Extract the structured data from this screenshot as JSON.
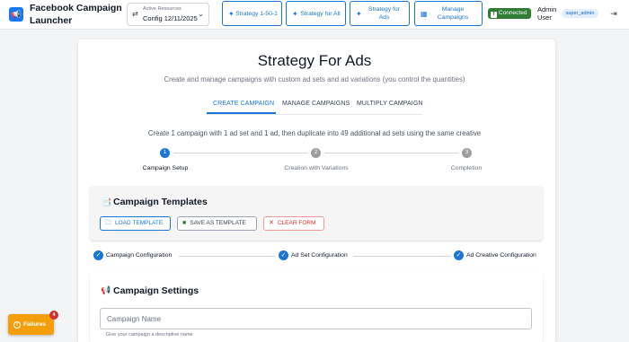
{
  "header": {
    "app_title": "Facebook Campaign Launcher",
    "active_resources_label": "Active Resources",
    "active_resources_value": "Config 12/11/2025",
    "nav": [
      {
        "label": "Strategy 1-50-1",
        "icon": "sparkle-icon"
      },
      {
        "label": "Strategy for All",
        "icon": "sparkle-icon"
      },
      {
        "label": "Strategy for Ads",
        "icon": "sparkle-icon"
      },
      {
        "label": "Manage Campaigns",
        "icon": "grid-icon"
      }
    ],
    "connection_status": "Connected",
    "user_name": "Admin User",
    "user_role": "super_admin"
  },
  "main": {
    "title": "Strategy For Ads",
    "subtitle": "Create and manage campaigns with custom ad sets and ad variations (you control the quantities)",
    "tabs": [
      {
        "label": "CREATE CAMPAIGN",
        "active": true
      },
      {
        "label": "MANAGE CAMPAIGNS",
        "active": false
      },
      {
        "label": "MULTIPLY CAMPAIGN",
        "active": false
      }
    ],
    "description": "Create 1 campaign with 1 ad set and 1 ad, then duplicate into 49 additional ad sets using the same creative",
    "steps": [
      {
        "number": "1",
        "label": "Campaign Setup",
        "active": true
      },
      {
        "number": "2",
        "label": "Creation with Variations",
        "active": false
      },
      {
        "number": "3",
        "label": "Completion",
        "active": false
      }
    ]
  },
  "templates": {
    "title": "Campaign Templates",
    "load_label": "LOAD TEMPLATE",
    "save_label": "SAVE AS TEMPLATE",
    "clear_label": "CLEAR FORM"
  },
  "config_steps": [
    {
      "label": "Campaign Configuration"
    },
    {
      "label": "Ad Set Configuration"
    },
    {
      "label": "Ad Creative Configuration"
    }
  ],
  "campaign_settings": {
    "title": "Campaign Settings",
    "name_placeholder": "Campaign Name",
    "name_value": "",
    "name_helper": "Give your campaign a descriptive name"
  },
  "failures": {
    "label": "Failures",
    "count": "4"
  },
  "colors": {
    "primary": "#1976d2",
    "connected": "#2e7d32",
    "failures": "#f59e0b",
    "danger": "#d32f2f"
  }
}
